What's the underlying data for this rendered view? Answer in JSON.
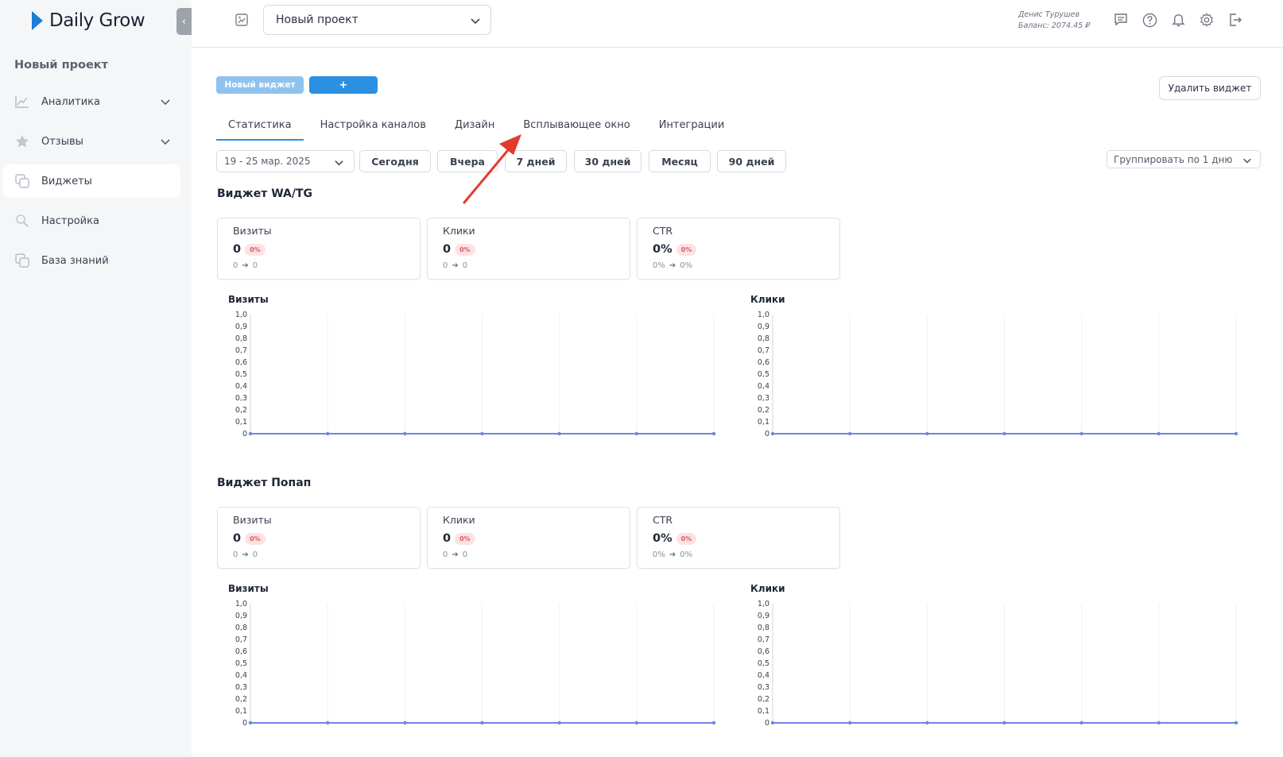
{
  "brand": {
    "name": "Daily Grow",
    "color": "#1f7bd8"
  },
  "sidebar": {
    "project_name": "Новый проект",
    "items": [
      {
        "label": "Аналитика",
        "icon": "chart-line-icon",
        "has_chevron": true,
        "active": false
      },
      {
        "label": "Отзывы",
        "icon": "star-icon",
        "has_chevron": true,
        "active": false
      },
      {
        "label": "Виджеты",
        "icon": "widgets-icon",
        "has_chevron": false,
        "active": true
      },
      {
        "label": "Настройка",
        "icon": "settings-icon",
        "has_chevron": false,
        "active": false
      },
      {
        "label": "База знаний",
        "icon": "knowledge-base-icon",
        "has_chevron": false,
        "active": false
      }
    ]
  },
  "header": {
    "project_select": "Новый проект",
    "user_name": "Денис Турушев",
    "balance": "Баланс: 2074.45 ₽",
    "icons": [
      "chat-icon",
      "help-icon",
      "bell-icon",
      "gear-icon",
      "logout-icon"
    ]
  },
  "toolbar": {
    "new_widget_label": "Новый виджет",
    "add_label": "+",
    "delete_label": "Удалить виджет"
  },
  "tabs": [
    {
      "label": "Статистика",
      "active": true
    },
    {
      "label": "Настройка каналов",
      "active": false
    },
    {
      "label": "Дизайн",
      "active": false
    },
    {
      "label": "Всплывающее окно",
      "active": false
    },
    {
      "label": "Интеграции",
      "active": false
    }
  ],
  "filters": {
    "date_range": "19 - 25 мар. 2025",
    "buttons": [
      "Сегодня",
      "Вчера",
      "7 дней",
      "30 дней",
      "Месяц",
      "90 дней"
    ],
    "group_by": "Группировать по 1 дню"
  },
  "sections": [
    {
      "title": "Виджет WA/TG",
      "cards": [
        {
          "title": "Визиты",
          "value": "0",
          "badge": "0%",
          "from": "0",
          "to": "0"
        },
        {
          "title": "Клики",
          "value": "0",
          "badge": "0%",
          "from": "0",
          "to": "0"
        },
        {
          "title": "CTR",
          "value": "0%",
          "badge": "0%",
          "from": "0%",
          "to": "0%"
        }
      ]
    },
    {
      "title": "Виджет Попап",
      "cards": [
        {
          "title": "Визиты",
          "value": "0",
          "badge": "0%",
          "from": "0",
          "to": "0"
        },
        {
          "title": "Клики",
          "value": "0",
          "badge": "0%",
          "from": "0",
          "to": "0"
        },
        {
          "title": "CTR",
          "value": "0%",
          "badge": "0%",
          "from": "0%",
          "to": "0%"
        }
      ]
    }
  ],
  "chart_data": [
    {
      "type": "line",
      "title": "Визиты",
      "x": [
        0,
        1,
        2,
        3,
        4,
        5,
        6
      ],
      "series": [
        {
          "values": [
            0,
            0,
            0,
            0,
            0,
            0,
            0
          ]
        }
      ],
      "ylim": [
        0,
        1
      ],
      "yticks": [
        "0",
        "0,1",
        "0,2",
        "0,3",
        "0,4",
        "0,5",
        "0,6",
        "0,7",
        "0,8",
        "0,9",
        "1,0"
      ],
      "grid": true,
      "color": "#6f86e0"
    },
    {
      "type": "line",
      "title": "Клики",
      "x": [
        0,
        1,
        2,
        3,
        4,
        5,
        6
      ],
      "series": [
        {
          "values": [
            0,
            0,
            0,
            0,
            0,
            0,
            0
          ]
        }
      ],
      "ylim": [
        0,
        1
      ],
      "yticks": [
        "0",
        "0,1",
        "0,2",
        "0,3",
        "0,4",
        "0,5",
        "0,6",
        "0,7",
        "0,8",
        "0,9",
        "1,0"
      ],
      "grid": true,
      "color": "#6f86e0"
    },
    {
      "type": "line",
      "title": "Визиты",
      "x": [
        0,
        1,
        2,
        3,
        4,
        5,
        6
      ],
      "series": [
        {
          "values": [
            0,
            0,
            0,
            0,
            0,
            0,
            0
          ]
        }
      ],
      "ylim": [
        0,
        1
      ],
      "yticks": [
        "0",
        "0,1",
        "0,2",
        "0,3",
        "0,4",
        "0,5",
        "0,6",
        "0,7",
        "0,8",
        "0,9",
        "1,0"
      ],
      "grid": true,
      "color": "#6f86e0"
    },
    {
      "type": "line",
      "title": "Клики",
      "x": [
        0,
        1,
        2,
        3,
        4,
        5,
        6
      ],
      "series": [
        {
          "values": [
            0,
            0,
            0,
            0,
            0,
            0,
            0
          ]
        }
      ],
      "ylim": [
        0,
        1
      ],
      "yticks": [
        "0",
        "0,1",
        "0,2",
        "0,3",
        "0,4",
        "0,5",
        "0,6",
        "0,7",
        "0,8",
        "0,9",
        "1,0"
      ],
      "grid": true,
      "color": "#6f86e0"
    }
  ],
  "colors": {
    "primary": "#2b8fe2",
    "primary_light": "#8fc2ef",
    "annotation_arrow": "#e23b2e"
  }
}
